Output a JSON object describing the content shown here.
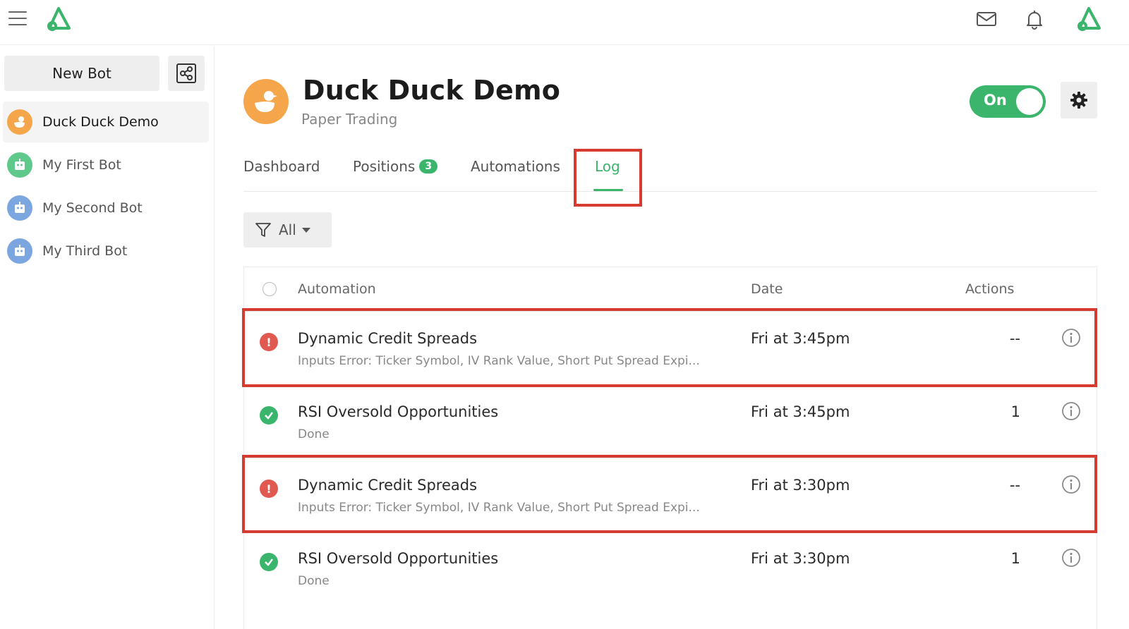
{
  "topbar": {
    "menu_icon": "hamburger-menu-icon",
    "logo_icon": "app-logo-icon",
    "mail_icon": "mail-icon",
    "bell_icon": "bell-icon",
    "user_logo_icon": "user-logo-icon"
  },
  "sidebar": {
    "new_bot_label": "New Bot",
    "share_icon": "share-icon",
    "bots": [
      {
        "name": "Duck Duck Demo",
        "avatar": "duck-icon",
        "active": true
      },
      {
        "name": "My First Bot",
        "avatar": "robot-icon",
        "active": false
      },
      {
        "name": "My Second Bot",
        "avatar": "robot-icon",
        "active": false
      },
      {
        "name": "My Third Bot",
        "avatar": "robot-icon",
        "active": false
      }
    ]
  },
  "header": {
    "title": "Duck Duck Demo",
    "subtitle": "Paper Trading",
    "toggle_label": "On",
    "settings_icon": "gear-icon"
  },
  "tabs": [
    {
      "label": "Dashboard",
      "badge": null,
      "active": false
    },
    {
      "label": "Positions",
      "badge": "3",
      "active": false
    },
    {
      "label": "Automations",
      "badge": null,
      "active": false
    },
    {
      "label": "Log",
      "badge": null,
      "active": true
    }
  ],
  "filter": {
    "label": "All",
    "icon": "filter-icon"
  },
  "table": {
    "columns": {
      "automation": "Automation",
      "date": "Date",
      "actions": "Actions"
    },
    "rows": [
      {
        "status": "error",
        "title": "Dynamic Credit Spreads",
        "subtitle": "Inputs Error: Ticker Symbol, IV Rank Value, Short Put Spread Expi...",
        "date": "Fri at 3:45pm",
        "actions": "--"
      },
      {
        "status": "done",
        "title": "RSI Oversold Opportunities",
        "subtitle": "Done",
        "date": "Fri at 3:45pm",
        "actions": "1"
      },
      {
        "status": "error",
        "title": "Dynamic Credit Spreads",
        "subtitle": "Inputs Error: Ticker Symbol, IV Rank Value, Short Put Spread Expi...",
        "date": "Fri at 3:30pm",
        "actions": "--"
      },
      {
        "status": "done",
        "title": "RSI Oversold Opportunities",
        "subtitle": "Done",
        "date": "Fri at 3:30pm",
        "actions": "1"
      }
    ]
  },
  "colors": {
    "accent": "#3bb56b",
    "error": "#e05a52",
    "highlight": "#d63b32",
    "duck_avatar": "#f5a64b",
    "robot_green": "#5ec98a",
    "robot_blue": "#7ba6e0"
  }
}
